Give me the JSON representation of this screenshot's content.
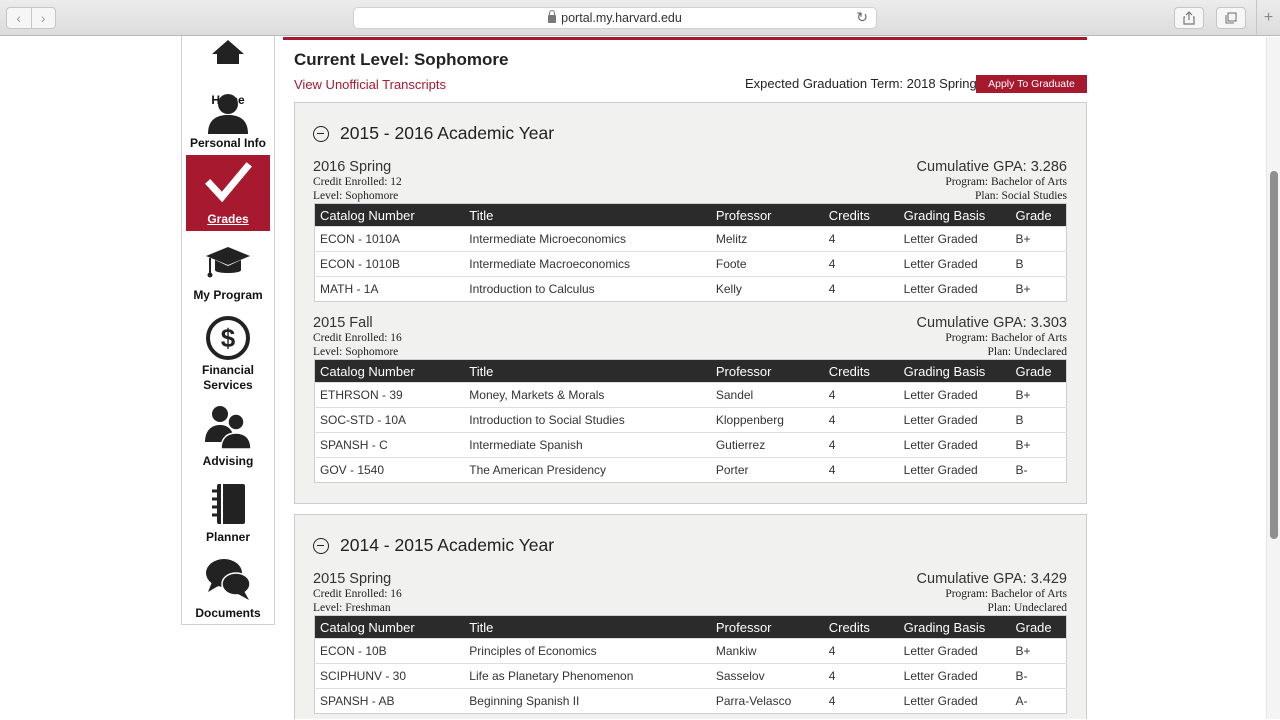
{
  "browser": {
    "url": "portal.my.harvard.edu",
    "back_icon": "chevron-left",
    "forward_icon": "chevron-right",
    "share_icon": "share",
    "tabs_icon": "tabs",
    "newtab_label": "+"
  },
  "sidebar": {
    "items": [
      {
        "label": "Home",
        "icon": "home-icon"
      },
      {
        "label": "Personal Info",
        "icon": "person-icon"
      },
      {
        "label": "Grades",
        "icon": "checkmark-icon",
        "active": true
      },
      {
        "label": "My Program",
        "icon": "graduation-cap-icon"
      },
      {
        "label": "Financial Services",
        "label_lines": [
          "Financial",
          "Services"
        ],
        "icon": "dollar-icon"
      },
      {
        "label": "Advising",
        "icon": "people-icon"
      },
      {
        "label": "Planner",
        "icon": "notebook-icon"
      },
      {
        "label": "Documents",
        "icon": "chat-bubbles-icon"
      }
    ]
  },
  "header": {
    "current_level": "Current Level: Sophomore",
    "transcripts_link": "View Unofficial Transcripts",
    "expected_graduation": "Expected Graduation Term: 2018 Spring",
    "apply_button": "Apply To Graduate"
  },
  "columns": [
    "Catalog Number",
    "Title",
    "Professor",
    "Credits",
    "Grading Basis",
    "Grade"
  ],
  "years": [
    {
      "title": "2015 - 2016 Academic Year",
      "terms": [
        {
          "name": "2016 Spring",
          "credit": "Credit Enrolled: 12",
          "level": "Level: Sophomore",
          "gpa": "Cumulative GPA: 3.286",
          "program": "Program: Bachelor of Arts",
          "plan": "Plan: Social Studies",
          "rows": [
            [
              "ECON - 1010A",
              "Intermediate Microeconomics",
              "Melitz",
              "4",
              "Letter Graded",
              "B+"
            ],
            [
              "ECON - 1010B",
              "Intermediate Macroeconomics",
              "Foote",
              "4",
              "Letter Graded",
              "B"
            ],
            [
              "MATH - 1A",
              "Introduction to Calculus",
              "Kelly",
              "4",
              "Letter Graded",
              "B+"
            ]
          ]
        },
        {
          "name": "2015 Fall",
          "credit": "Credit Enrolled: 16",
          "level": "Level: Sophomore",
          "gpa": "Cumulative GPA: 3.303",
          "program": "Program: Bachelor of Arts",
          "plan": "Plan: Undeclared",
          "rows": [
            [
              "ETHRSON - 39",
              "Money, Markets & Morals",
              "Sandel",
              "4",
              "Letter Graded",
              "B+"
            ],
            [
              "SOC-STD - 10A",
              "Introduction to Social Studies",
              "Kloppenberg",
              "4",
              "Letter Graded",
              "B"
            ],
            [
              "SPANSH - C",
              "Intermediate Spanish",
              "Gutierrez",
              "4",
              "Letter Graded",
              "B+"
            ],
            [
              "GOV - 1540",
              "The American Presidency",
              "Porter",
              "4",
              "Letter Graded",
              "B-"
            ]
          ]
        }
      ]
    },
    {
      "title": "2014 - 2015 Academic Year",
      "terms": [
        {
          "name": "2015 Spring",
          "credit": "Credit Enrolled: 16",
          "level": "Level: Freshman",
          "gpa": "Cumulative GPA: 3.429",
          "program": "Program: Bachelor of Arts",
          "plan": "Plan: Undeclared",
          "rows": [
            [
              "ECON - 10B",
              "Principles of Economics",
              "Mankiw",
              "4",
              "Letter Graded",
              "B+"
            ],
            [
              "SCIPHUNV - 30",
              "Life as Planetary Phenomenon",
              "Sasselov",
              "4",
              "Letter Graded",
              "B-"
            ],
            [
              "SPANSH - AB",
              "Beginning Spanish II",
              "Parra-Velasco",
              "4",
              "Letter Graded",
              "A-"
            ]
          ]
        }
      ]
    }
  ],
  "colors": {
    "accent": "#a6192e",
    "table_header": "#2b2b2b",
    "panel": "#f1f1f0"
  }
}
